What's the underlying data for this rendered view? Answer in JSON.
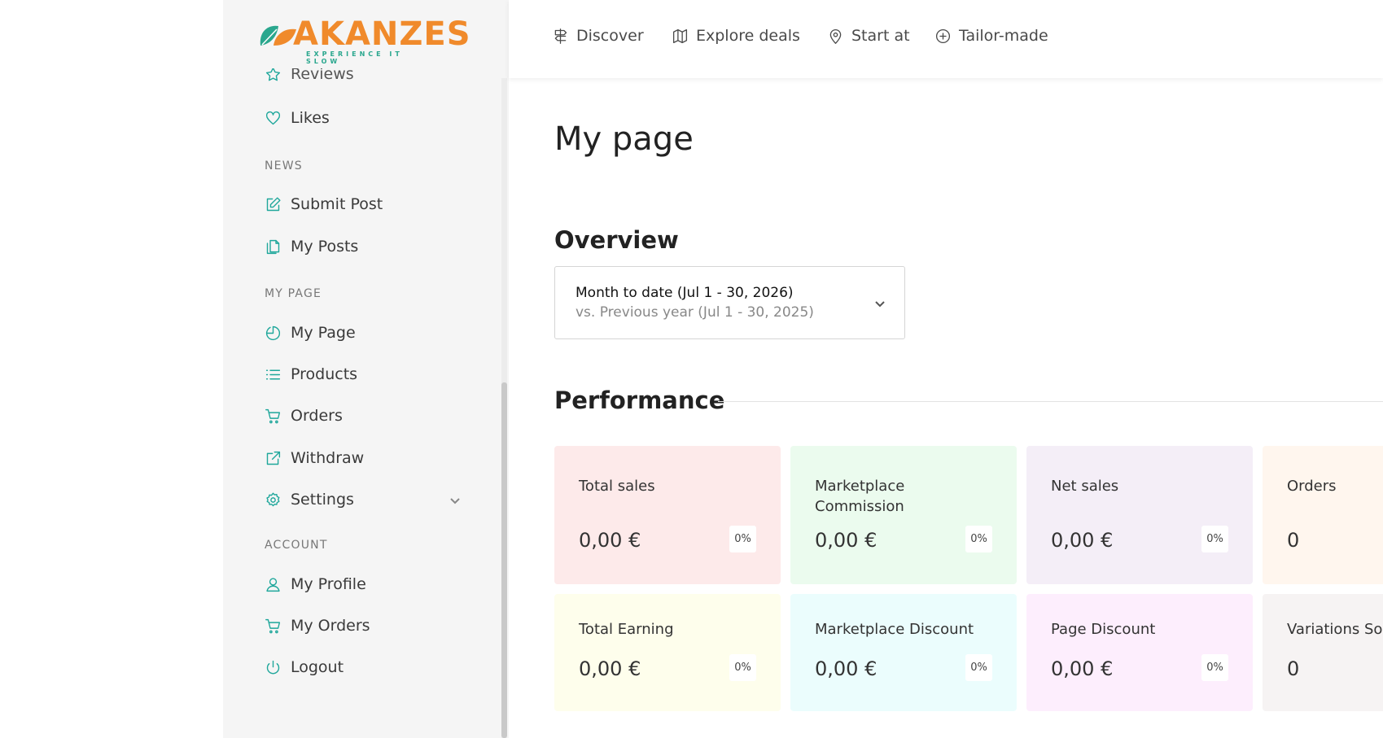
{
  "logo": {
    "word": "AKANZES",
    "tagline": "EXPERIENCE IT SLOW"
  },
  "sidebar": {
    "partial_item": "Reviews",
    "likes": "Likes",
    "sections": {
      "news": "NEWS",
      "my_page": "MY PAGE",
      "account": "ACCOUNT"
    },
    "news_items": [
      "Submit Post",
      "My Posts"
    ],
    "my_page_items": [
      "My Page",
      "Products",
      "Orders",
      "Withdraw",
      "Settings"
    ],
    "account_items": [
      "My Profile",
      "My Orders",
      "Logout"
    ]
  },
  "topnav": {
    "discover": "Discover",
    "explore": "Explore deals",
    "start": "Start at",
    "tailor": "Tailor-made"
  },
  "main": {
    "title": "My page",
    "overview": "Overview",
    "date_main": "Month to date (Jul 1 - 30, 2026)",
    "date_sub": "vs. Previous year (Jul 1 - 30, 2025)",
    "performance": "Performance"
  },
  "cards": [
    {
      "label": "Total sales",
      "value": "0,00 €",
      "pct": "0%",
      "bg": "#fdeaea"
    },
    {
      "label": "Marketplace Commission",
      "value": "0,00 €",
      "pct": "0%",
      "bg": "#ebfbee"
    },
    {
      "label": "Net sales",
      "value": "0,00 €",
      "pct": "0%",
      "bg": "#f4eef7"
    },
    {
      "label": "Orders",
      "value": "0",
      "pct": "",
      "bg": "#fff6ee"
    },
    {
      "label": "Total Earning",
      "value": "0,00 €",
      "pct": "0%",
      "bg": "#fefeec"
    },
    {
      "label": "Marketplace Discount",
      "value": "0,00 €",
      "pct": "0%",
      "bg": "#ebfdfd"
    },
    {
      "label": "Page Discount",
      "value": "0,00 €",
      "pct": "0%",
      "bg": "#fdeefd"
    },
    {
      "label": "Variations Sold",
      "value": "0",
      "pct": "",
      "bg": "#f6f3f3"
    }
  ],
  "colors": {
    "accent": "#1fa79b",
    "sidebar_bg": "#f5f5f5"
  }
}
